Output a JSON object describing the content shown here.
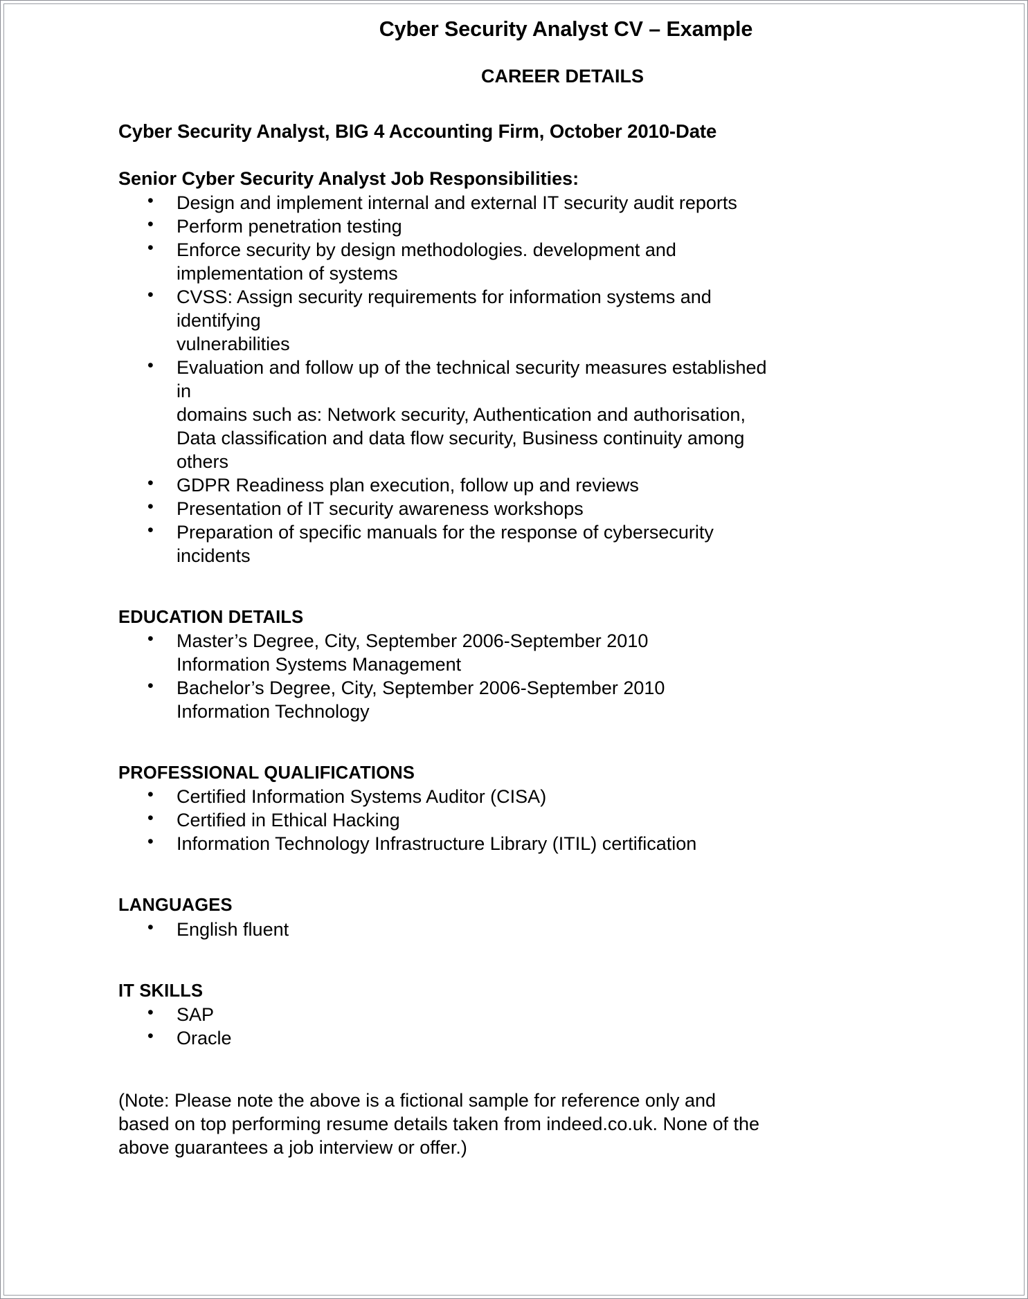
{
  "document": {
    "title": "Cyber Security Analyst CV – Example",
    "career_heading": "CAREER DETAILS",
    "job_line": "Cyber Security Analyst, BIG 4 Accounting Firm, October 2010-Date",
    "responsibilities_heading": "Senior Cyber Security Analyst Job Responsibilities:",
    "responsibilities": [
      {
        "lines": [
          "Design and implement internal and external IT security audit reports"
        ]
      },
      {
        "lines": [
          "Perform penetration testing"
        ]
      },
      {
        "lines": [
          "Enforce security by design methodologies. development and",
          "implementation of systems"
        ]
      },
      {
        "lines": [
          "CVSS: Assign security requirements for information systems and",
          "identifying",
          "vulnerabilities"
        ]
      },
      {
        "lines": [
          "Evaluation and follow up of the technical security measures established",
          "in",
          "domains such as: Network security, Authentication and authorisation,",
          "Data classification and data flow security, Business continuity among",
          "others"
        ]
      },
      {
        "lines": [
          "GDPR Readiness plan execution, follow up and reviews"
        ]
      },
      {
        "lines": [
          "Presentation of IT security awareness workshops"
        ]
      },
      {
        "lines": [
          "Preparation of specific manuals for the response of cybersecurity",
          "incidents"
        ]
      }
    ],
    "education_heading": "EDUCATION DETAILS",
    "education": [
      {
        "lines": [
          "Master’s Degree, City, September 2006-September 2010",
          "Information Systems Management"
        ]
      },
      {
        "lines": [
          "Bachelor’s Degree, City, September 2006-September 2010",
          "Information Technology"
        ]
      }
    ],
    "qualifications_heading": "PROFESSIONAL QUALIFICATIONS",
    "qualifications": [
      {
        "lines": [
          "Certified Information Systems Auditor (CISA)"
        ]
      },
      {
        "lines": [
          "Certified in Ethical Hacking"
        ]
      },
      {
        "lines": [
          "Information Technology Infrastructure Library (ITIL) certification"
        ]
      }
    ],
    "languages_heading": "LANGUAGES",
    "languages": [
      {
        "lines": [
          "English fluent"
        ]
      }
    ],
    "it_skills_heading": "IT SKILLS",
    "it_skills": [
      {
        "lines": [
          "SAP"
        ]
      },
      {
        "lines": [
          "Oracle"
        ]
      }
    ],
    "note_lines": [
      "(Note: Please note the above is a fictional sample for reference only and",
      "based on top performing resume details taken from indeed.co.uk. None of the",
      "above guarantees a job interview or offer.)"
    ]
  }
}
